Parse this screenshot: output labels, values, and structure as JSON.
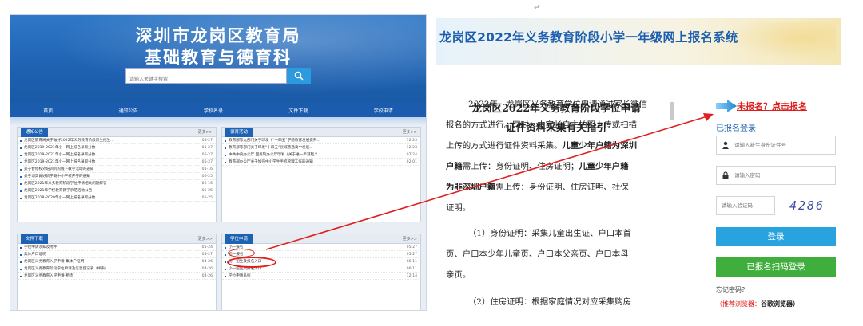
{
  "colors": {
    "brand": "#1e62b3",
    "accent_red": "#e01e1e",
    "login_btn": "#29a3e0",
    "reg_btn": "#3fae3c"
  },
  "marker": "↵",
  "left_site": {
    "title_line1": "深圳市龙岗区教育局",
    "title_line2": "基础教育与德育科",
    "search_placeholder": "请输入关键字搜索",
    "search_icon": "search-icon",
    "nav": [
      "首页",
      "通知公告",
      "学校名录",
      "文件下载",
      "学校申请"
    ],
    "panels": [
      {
        "title": "通知公告",
        "more": "更多>>",
        "rows": [
          {
            "text": "龙岗区教育局关于做好2022年义务教育阶段新生招生...",
            "date": "05-27"
          },
          {
            "text": "龙岗区2019-2021年小一网上报名录取分数",
            "date": "05-27"
          },
          {
            "text": "龙岗区2019-2021年小一网上报名录取分数",
            "date": "05-27"
          },
          {
            "text": "龙岗区2019-2021年小一网上报名录取分数",
            "date": "05-27"
          },
          {
            "text": "关于暂停校外培训机构线下教学活动的通知",
            "date": "01-16"
          },
          {
            "text": "关于切实做好新学期中小学校开学的通知",
            "date": "06-25"
          },
          {
            "text": "龙岗区2021年义务教育阶段学位申请相关问题解答",
            "date": "06-16"
          },
          {
            "text": "龙岗区2021年学校教育教学示范活动公告",
            "date": "05-25"
          },
          {
            "text": "龙岗区2018-2020年小一网上报名录取分数",
            "date": "05-25"
          }
        ]
      },
      {
        "title": "德育活动",
        "more": "更多>>",
        "rows": [
          {
            "text": "教育部等九部门关于印发《“十四五”学前教育发展提升...",
            "date": "12-23"
          },
          {
            "text": "教育部等部门关于印发“十四五”县域普通高中发展...",
            "date": "12-23"
          },
          {
            "text": "中共中央办公厅 国务院办公厅印发《关于进一步减轻义...",
            "date": "07-24"
          },
          {
            "text": "教育部办公厅关于加强中小学生手机管理工作的通知",
            "date": "02-01"
          }
        ]
      },
      {
        "title": "文件下载",
        "more": "更多>>",
        "rows": [
          {
            "text": "学位申请须知及附件",
            "date": "05-24"
          },
          {
            "text": "集体户口证明",
            "date": "05-27"
          },
          {
            "text": "龙岗区义务教育入学申请-集体户证明",
            "date": "04-26"
          },
          {
            "text": "龙岗区义务教育阶段学位申请及信息登记表（样表）",
            "date": "04-26"
          },
          {
            "text": "龙岗区义务教育入学申请-租赁",
            "date": "04-26"
          }
        ]
      },
      {
        "title": "学位申请",
        "more": "更多>>",
        "rows": [
          {
            "text": "小一报名",
            "date": "05-27"
          },
          {
            "text": "初一报名",
            "date": "05-27"
          },
          {
            "text": "初一招生及报名入口",
            "date": "06-11"
          },
          {
            "text": "小一招生及报名入口",
            "date": "06-11"
          },
          {
            "text": "学位申请系统",
            "date": "12-14"
          }
        ]
      }
    ]
  },
  "right_page": {
    "title": "龙岗区2022年义务教育阶段小学一年级网上报名系统",
    "doc": {
      "title_line1": "龙岗区2022年义务教育阶段学位申请",
      "title_line2": "证件资料采集有关指引",
      "lines": [
        {
          "plain": "2022年，龙岗区义务教育学位申请通过家长微信"
        },
        {
          "plain": "报名的方式进行。同时，由家长自主拍照上传或扫描"
        },
        {
          "plain": "上传的方式进行证件资料采集。",
          "bold": "儿童少年户籍为深圳"
        },
        {
          "bold": "户籍",
          "plain": "需上传：身份证明、住房证明；",
          "bold2": "儿童少年户籍"
        },
        {
          "bold": "为非深圳户籍",
          "plain": "需上传：身份证明、住房证明、社保"
        },
        {
          "plain": "证明。"
        },
        {
          "plain": "（1）身份证明：采集儿童出生证、户口本首"
        },
        {
          "plain": "页、户口本少年儿童页、户口本父亲页、户口本母"
        },
        {
          "plain": "亲页。"
        },
        {
          "plain": "（2）住房证明：根据家庭情况对应采集购房"
        }
      ]
    },
    "login": {
      "register_link": "未报名？点击报名",
      "header": "已报名登录",
      "id_placeholder": "请输入新生身份证件号",
      "pwd_placeholder": "请输入密码",
      "captcha_placeholder": "请输入验证码",
      "captcha_value": "4286",
      "login_button": "登录",
      "scan_button": "已报名扫码登录",
      "forgot": "忘记密码?",
      "recommend_label": "（推荐浏览器：",
      "recommend_value": "谷歌浏览器）"
    }
  }
}
